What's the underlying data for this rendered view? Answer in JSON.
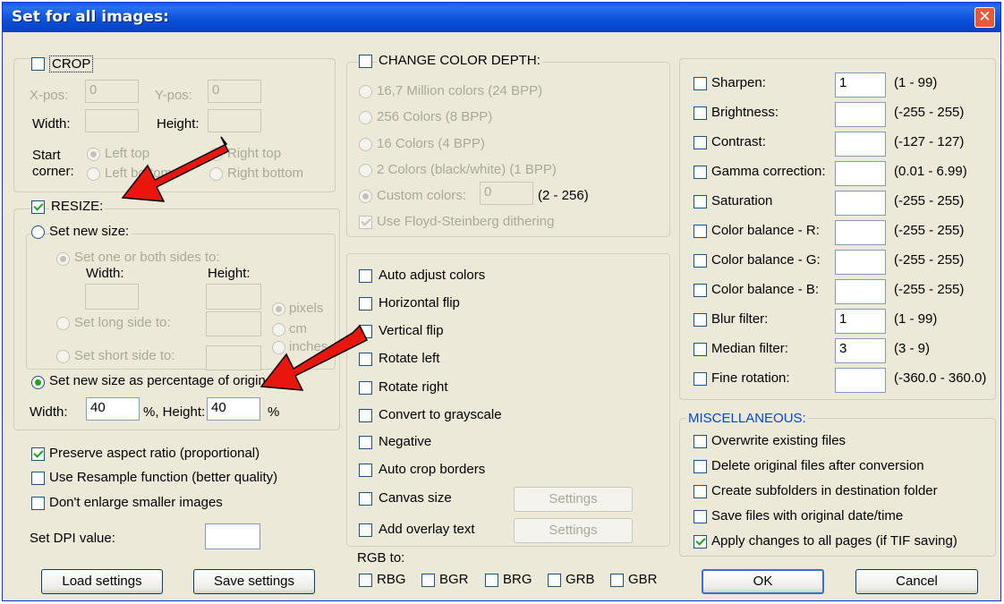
{
  "window": {
    "title": "Set for all images:",
    "close_glyph": "✕"
  },
  "crop": {
    "label": "CROP",
    "xpos_label": "X-pos:",
    "xpos_value": "0",
    "ypos_label": "Y-pos:",
    "ypos_value": "0",
    "width_label": "Width:",
    "height_label": "Height:",
    "start_label": "Start",
    "corner_label": "corner:",
    "left_top": "Left top",
    "right_top": "Right top",
    "left_bottom": "Left bottom",
    "right_bottom": "Right bottom"
  },
  "resize": {
    "label": "RESIZE:",
    "set_new_size": "Set new size:",
    "set_one_or_both": "Set one or both sides to:",
    "width_label": "Width:",
    "height_label": "Height:",
    "set_long_side": "Set long side to:",
    "set_short_side": "Set short side to:",
    "unit_pixels": "pixels",
    "unit_cm": "cm",
    "unit_inches": "inches",
    "set_percentage": "Set new size as percentage of original",
    "pct_width_label": "Width:",
    "pct_width_value": "40",
    "pct_height_label": "%, Height:",
    "pct_height_value": "40",
    "pct_suffix": "%"
  },
  "options": {
    "preserve_aspect": "Preserve aspect ratio (proportional)",
    "use_resample": "Use Resample function (better quality)",
    "dont_enlarge": "Don't enlarge smaller images",
    "set_dpi": "Set DPI value:"
  },
  "color_depth": {
    "label": "CHANGE COLOR DEPTH:",
    "opt_24": "16,7 Million colors (24 BPP)",
    "opt_8": "256 Colors (8 BPP)",
    "opt_4": "16 Colors (4 BPP)",
    "opt_1": "2 Colors (black/white) (1 BPP)",
    "opt_custom": "Custom colors:",
    "custom_value": "0",
    "custom_range": "(2 - 256)",
    "floyd": "Use Floyd-Steinberg dithering"
  },
  "effects": {
    "auto_adjust": "Auto adjust colors",
    "hflip": "Horizontal flip",
    "vflip": "Vertical flip",
    "rotate_left": "Rotate left",
    "rotate_right": "Rotate right",
    "grayscale": "Convert to grayscale",
    "negative": "Negative",
    "auto_crop": "Auto crop borders",
    "canvas_size": "Canvas size",
    "overlay_text": "Add overlay text",
    "settings": "Settings",
    "rgb_to": "RGB to:",
    "rgb_options": [
      "RBG",
      "BGR",
      "BRG",
      "GRB",
      "GBR"
    ]
  },
  "adjustments": [
    {
      "label": "Sharpen:",
      "value": "1",
      "range": "(1  -  99)"
    },
    {
      "label": "Brightness:",
      "value": "",
      "range": "(-255  -  255)"
    },
    {
      "label": "Contrast:",
      "value": "",
      "range": "(-127  -  127)"
    },
    {
      "label": "Gamma correction:",
      "value": "",
      "range": "(0.01  -  6.99)"
    },
    {
      "label": "Saturation",
      "value": "",
      "range": "(-255  -  255)"
    },
    {
      "label": "Color balance - R:",
      "value": "",
      "range": "(-255  -  255)"
    },
    {
      "label": "Color balance - G:",
      "value": "",
      "range": "(-255  -  255)"
    },
    {
      "label": "Color balance - B:",
      "value": "",
      "range": "(-255  -  255)"
    },
    {
      "label": "Blur filter:",
      "value": "1",
      "range": "(1  -  99)"
    },
    {
      "label": "Median filter:",
      "value": "3",
      "range": "(3  -  9)"
    },
    {
      "label": "Fine rotation:",
      "value": "",
      "range": "(-360.0  -  360.0)"
    }
  ],
  "misc": {
    "label": "MISCELLANEOUS:",
    "overwrite": "Overwrite existing files",
    "delete_original": "Delete original files after conversion",
    "create_subfolders": "Create subfolders in destination folder",
    "save_original_date": "Save files with original date/time",
    "apply_all_pages": "Apply changes to all pages (if TIF saving)"
  },
  "buttons": {
    "load_settings": "Load settings",
    "save_settings": "Save settings",
    "ok": "OK",
    "cancel": "Cancel"
  },
  "colors": {
    "title_bar": "#0a5fe8",
    "dialog_bg": "#ece9d8",
    "annotation_arrow": "#e8160c",
    "check_mark": "#21a121"
  }
}
